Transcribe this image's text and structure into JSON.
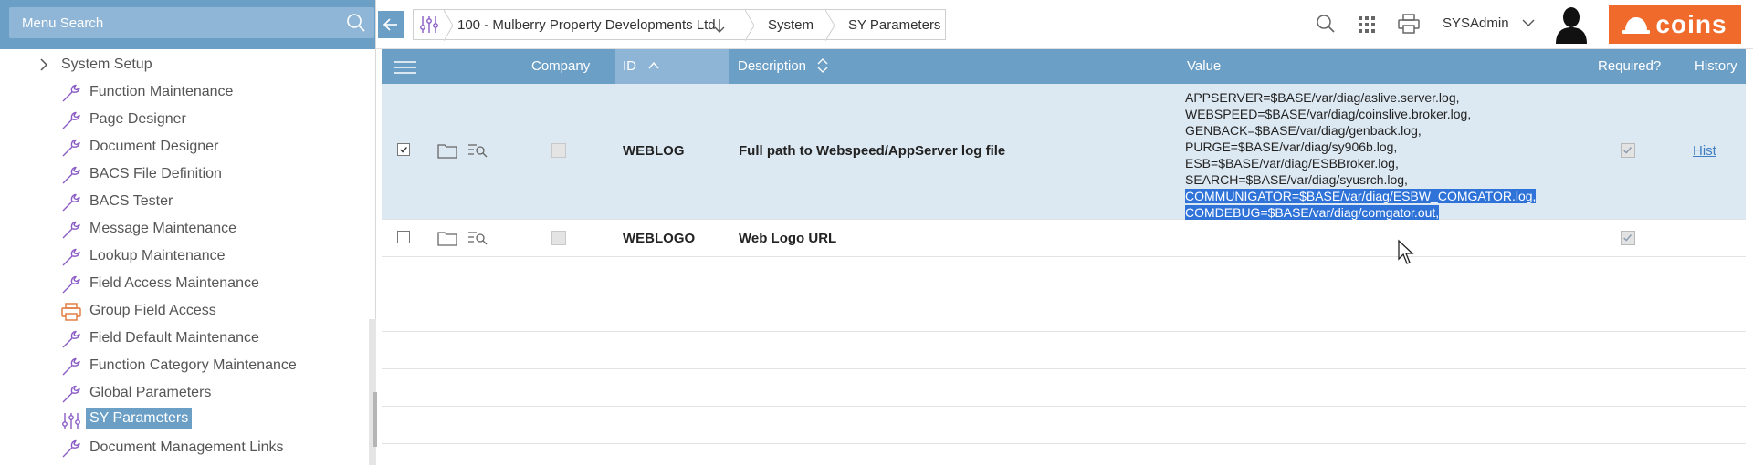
{
  "sidebar": {
    "search_placeholder": "Menu Search",
    "parent": {
      "label": "System Setup",
      "icon": "chevron-right-icon"
    },
    "items": [
      {
        "label": "Function Maintenance",
        "icon": "wrench-icon"
      },
      {
        "label": "Page Designer",
        "icon": "wrench-icon"
      },
      {
        "label": "Document Designer",
        "icon": "wrench-icon"
      },
      {
        "label": "BACS File Definition",
        "icon": "wrench-icon"
      },
      {
        "label": "BACS Tester",
        "icon": "wrench-icon"
      },
      {
        "label": "Message Maintenance",
        "icon": "wrench-icon"
      },
      {
        "label": "Lookup Maintenance",
        "icon": "wrench-icon"
      },
      {
        "label": "Field Access Maintenance",
        "icon": "wrench-icon"
      },
      {
        "label": "Group Field Access",
        "icon": "printer-icon"
      },
      {
        "label": "Field Default Maintenance",
        "icon": "wrench-icon"
      },
      {
        "label": "Function Category Maintenance",
        "icon": "wrench-icon"
      },
      {
        "label": "Global Parameters",
        "icon": "wrench-icon"
      },
      {
        "label": "SY Parameters",
        "icon": "sliders-icon",
        "active": true
      },
      {
        "label": "Document Management Links",
        "icon": "wrench-icon"
      }
    ]
  },
  "breadcrumb": {
    "company": "100 - Mulberry Property Developments Ltd",
    "module": "System",
    "page": "SY Parameters"
  },
  "user": {
    "name": "SYSAdmin"
  },
  "brand": {
    "name": "coins",
    "color": "#ef6a2b"
  },
  "grid": {
    "columns": {
      "company": "Company",
      "id": "ID",
      "description": "Description",
      "value": "Value",
      "required": "Required?",
      "history": "History"
    },
    "rows": [
      {
        "selected": true,
        "id": "WEBLOG",
        "description": "Full path to Webspeed/AppServer log file",
        "value_lines": [
          "APPSERVER=$BASE/var/diag/aslive.server.log,",
          "WEBSPEED=$BASE/var/diag/coinslive.broker.log,",
          "GENBACK=$BASE/var/diag/genback.log,",
          "PURGE=$BASE/var/diag/sy906b.log,",
          "ESB=$BASE/var/diag/ESBBroker.log,",
          "SEARCH=$BASE/var/diag/syusrch.log,",
          "COMMUNIGATOR=$BASE/var/diag/ESBW_COMGATOR.log,",
          "COMDEBUG=$BASE/var/diag/comgator.out,"
        ],
        "highlighted_from_line": 6,
        "required": true,
        "history": "Hist"
      },
      {
        "selected": false,
        "id": "WEBLOGO",
        "description": "Web Logo URL",
        "value_lines": [],
        "required": true,
        "history": ""
      }
    ]
  },
  "colors": {
    "header": "#6c9fc6",
    "selected_row": "#dde9f2",
    "accent_purple": "#8a5bc4",
    "highlight": "#2f73d8"
  }
}
